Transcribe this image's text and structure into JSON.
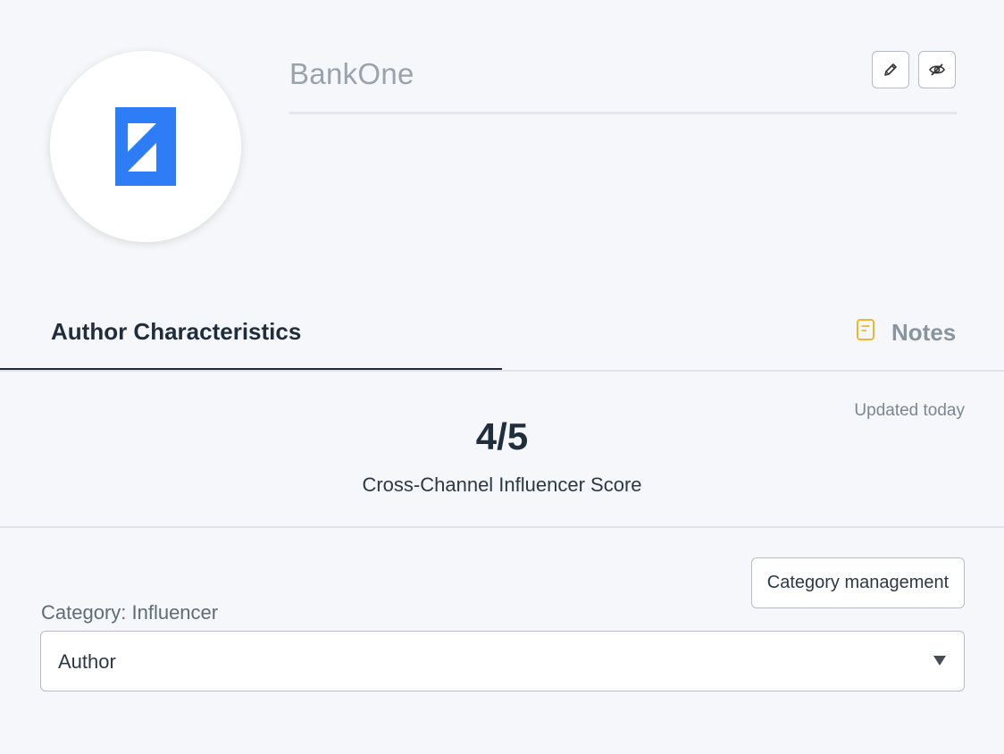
{
  "header": {
    "name": "BankOne",
    "logo_icon": "bankone-logo-icon",
    "actions": {
      "edit_icon": "pencil-icon",
      "hide_icon": "eye-slash-icon"
    }
  },
  "tabs": [
    {
      "label": "Author Characteristics",
      "active": true
    },
    {
      "label": "Notes",
      "icon": "note-icon",
      "active": false
    }
  ],
  "score": {
    "updated": "Updated today",
    "value": "4/5",
    "label": "Cross-Channel Influencer Score"
  },
  "category": {
    "management_button": "Category management",
    "label": "Category: Influencer",
    "selected": "Author",
    "caret_icon": "caret-down-icon"
  },
  "colors": {
    "brand_blue": "#2f7df6",
    "text_dark": "#1f2d3d",
    "notes_icon": "#f2b530",
    "background": "#f5f7fa"
  }
}
